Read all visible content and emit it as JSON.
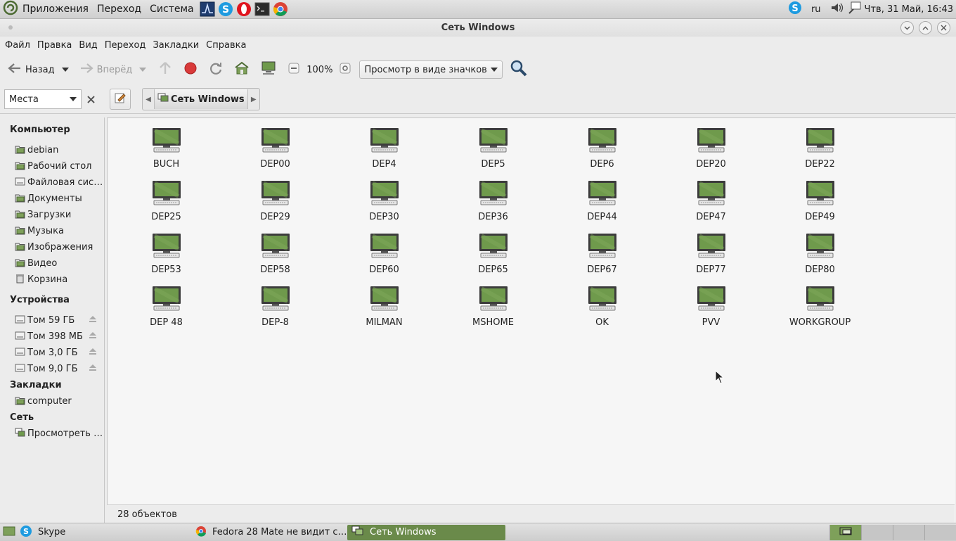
{
  "top_panel": {
    "menus": [
      "Приложения",
      "Переход",
      "Система"
    ],
    "launchers": [
      "terminal-monitor-icon",
      "skype-icon",
      "opera-icon",
      "terminal-icon",
      "chrome-icon"
    ],
    "lang": "ru",
    "clock": "Чтв, 31 Май, 16:43"
  },
  "window": {
    "title": "Сеть Windows",
    "menubar": [
      "Файл",
      "Правка",
      "Вид",
      "Переход",
      "Закладки",
      "Справка"
    ],
    "toolbar": {
      "back": "Назад",
      "forward": "Вперёд",
      "zoom": "100%",
      "view_mode": "Просмотр в виде значков"
    },
    "location": {
      "places": "Места",
      "path_current": "Сеть Windows"
    },
    "sidebar": {
      "computer": {
        "header": "Компьютер",
        "items": [
          "debian",
          "Рабочий стол",
          "Файловая сис…",
          "Документы",
          "Загрузки",
          "Музыка",
          "Изображения",
          "Видео",
          "Корзина"
        ]
      },
      "devices": {
        "header": "Устройства",
        "items": [
          "Том 59 ГБ",
          "Том 398 МБ",
          "Том 3,0 ГБ",
          "Том 9,0 ГБ"
        ]
      },
      "bookmarks": {
        "header": "Закладки",
        "items": [
          "computer"
        ]
      },
      "network": {
        "header": "Сеть",
        "items": [
          "Просмотреть …"
        ]
      }
    },
    "items": [
      "BUCH",
      "DEP00",
      "DEP4",
      "DEP5",
      "DEP6",
      "DEP20",
      "DEP22",
      "DEP25",
      "DEP29",
      "DEP30",
      "DEP36",
      "DEP44",
      "DEP47",
      "DEP49",
      "DEP53",
      "DEP58",
      "DEP60",
      "DEP65",
      "DEP67",
      "DEP77",
      "DEP80",
      "DEP 48",
      "DEP-8",
      "MILMAN",
      "MSHOME",
      "OK",
      "PVV",
      "WORKGROUP"
    ],
    "status": "28 объектов"
  },
  "taskbar": {
    "tasks": [
      "Skype",
      "Fedora 28 Mate не видит с…",
      "Сеть Windows"
    ]
  },
  "colors": {
    "accent": "#6a8a4a",
    "screen_green": "#6f9a4c"
  }
}
